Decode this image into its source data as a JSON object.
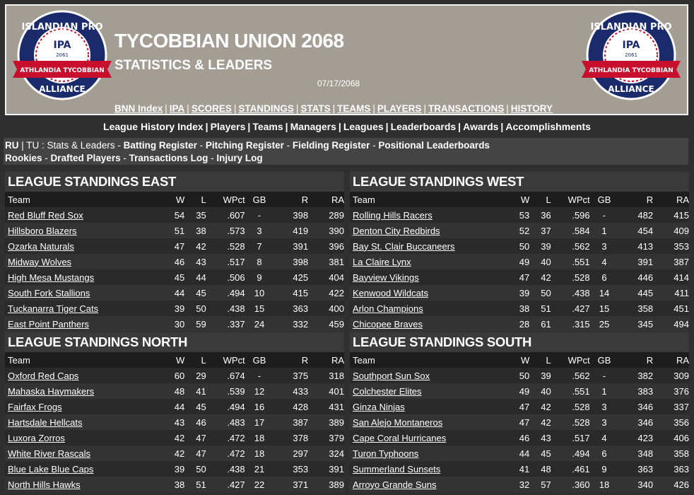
{
  "header": {
    "title": "TYCOBBIAN UNION 2068",
    "subtitle": "STATISTICS & LEADERS",
    "date": "07/17/2068",
    "logo": {
      "top_text": "ISLANDIAN PRO",
      "abbr": "IPA",
      "year": "2061",
      "ribbon": "ATHLANDIA TYCOBBIAN",
      "bottom_text": "ALLIANCE"
    }
  },
  "topnav": [
    "BNN Index",
    "IPA",
    "SCORES",
    "STANDINGS",
    "STATS",
    "TEAMS",
    "PLAYERS",
    "TRANSACTIONS",
    "HISTORY"
  ],
  "subnav": [
    "League History Index",
    "Players",
    "Teams",
    "Managers",
    "Leagues",
    "Leaderboards",
    "Awards",
    "Accomplishments"
  ],
  "breadcrumb": {
    "root": "RU",
    "current": "TU : Stats & Leaders",
    "line1_links": [
      "Batting Register",
      "Pitching Register",
      "Fielding Register",
      "Positional Leaderboards"
    ],
    "line2_links": [
      "Rookies",
      "Drafted Players",
      "Transactions Log",
      "Injury Log"
    ]
  },
  "columns": [
    "Team",
    "W",
    "L",
    "WPct",
    "GB",
    "R",
    "RA"
  ],
  "standings": {
    "east": {
      "title": "LEAGUE STANDINGS EAST",
      "rows": [
        [
          "Red Bluff Red Sox",
          "54",
          "35",
          ".607",
          "-",
          "398",
          "289"
        ],
        [
          "Hillsboro Blazers",
          "51",
          "38",
          ".573",
          "3",
          "419",
          "390"
        ],
        [
          "Ozarka Naturals",
          "47",
          "42",
          ".528",
          "7",
          "391",
          "396"
        ],
        [
          "Midway Wolves",
          "46",
          "43",
          ".517",
          "8",
          "398",
          "381"
        ],
        [
          "High Mesa Mustangs",
          "45",
          "44",
          ".506",
          "9",
          "425",
          "404"
        ],
        [
          "South Fork Stallions",
          "44",
          "45",
          ".494",
          "10",
          "415",
          "422"
        ],
        [
          "Tuckanarra Tiger Cats",
          "39",
          "50",
          ".438",
          "15",
          "363",
          "400"
        ],
        [
          "East Point Panthers",
          "30",
          "59",
          ".337",
          "24",
          "332",
          "459"
        ]
      ]
    },
    "west": {
      "title": "LEAGUE STANDINGS WEST",
      "rows": [
        [
          "Rolling Hills Racers",
          "53",
          "36",
          ".596",
          "-",
          "482",
          "415"
        ],
        [
          "Denton City Redbirds",
          "52",
          "37",
          ".584",
          "1",
          "454",
          "409"
        ],
        [
          "Bay St. Clair Buccaneers",
          "50",
          "39",
          ".562",
          "3",
          "413",
          "353"
        ],
        [
          "La Claire Lynx",
          "49",
          "40",
          ".551",
          "4",
          "391",
          "387"
        ],
        [
          "Bayview Vikings",
          "47",
          "42",
          ".528",
          "6",
          "446",
          "414"
        ],
        [
          "Kenwood Wildcats",
          "39",
          "50",
          ".438",
          "14",
          "445",
          "411"
        ],
        [
          "Arlon Champions",
          "38",
          "51",
          ".427",
          "15",
          "358",
          "451"
        ],
        [
          "Chicopee Braves",
          "28",
          "61",
          ".315",
          "25",
          "345",
          "494"
        ]
      ]
    },
    "north": {
      "title": "LEAGUE STANDINGS NORTH",
      "rows": [
        [
          "Oxford Red Caps",
          "60",
          "29",
          ".674",
          "-",
          "375",
          "318"
        ],
        [
          "Mahaska Haymakers",
          "48",
          "41",
          ".539",
          "12",
          "433",
          "401"
        ],
        [
          "Fairfax Frogs",
          "44",
          "45",
          ".494",
          "16",
          "428",
          "431"
        ],
        [
          "Hartsdale Hellcats",
          "43",
          "46",
          ".483",
          "17",
          "387",
          "389"
        ],
        [
          "Luxora Zorros",
          "42",
          "47",
          ".472",
          "18",
          "378",
          "379"
        ],
        [
          "White River Rascals",
          "42",
          "47",
          ".472",
          "18",
          "297",
          "324"
        ],
        [
          "Blue Lake Blue Caps",
          "39",
          "50",
          ".438",
          "21",
          "353",
          "391"
        ],
        [
          "North Hills Hawks",
          "38",
          "51",
          ".427",
          "22",
          "371",
          "389"
        ]
      ]
    },
    "south": {
      "title": "LEAGUE STANDINGS SOUTH",
      "rows": [
        [
          "Southport Sun Sox",
          "50",
          "39",
          ".562",
          "-",
          "382",
          "309"
        ],
        [
          "Colchester Elites",
          "49",
          "40",
          ".551",
          "1",
          "383",
          "376"
        ],
        [
          "Ginza Ninjas",
          "47",
          "42",
          ".528",
          "3",
          "346",
          "337"
        ],
        [
          "San Alejo Montaneros",
          "47",
          "42",
          ".528",
          "3",
          "346",
          "356"
        ],
        [
          "Cape Coral Hurricanes",
          "46",
          "43",
          ".517",
          "4",
          "423",
          "406"
        ],
        [
          "Turon Typhoons",
          "44",
          "45",
          ".494",
          "6",
          "348",
          "358"
        ],
        [
          "Summerland Sunsets",
          "41",
          "48",
          ".461",
          "9",
          "363",
          "363"
        ],
        [
          "Arroyo Grande Suns",
          "32",
          "57",
          ".360",
          "18",
          "340",
          "426"
        ]
      ]
    }
  },
  "colors": {
    "header_bg": "#a39d94",
    "page_bg": "#2f2f2f",
    "logo_red": "#c8102e",
    "logo_navy": "#1b2a6b"
  }
}
